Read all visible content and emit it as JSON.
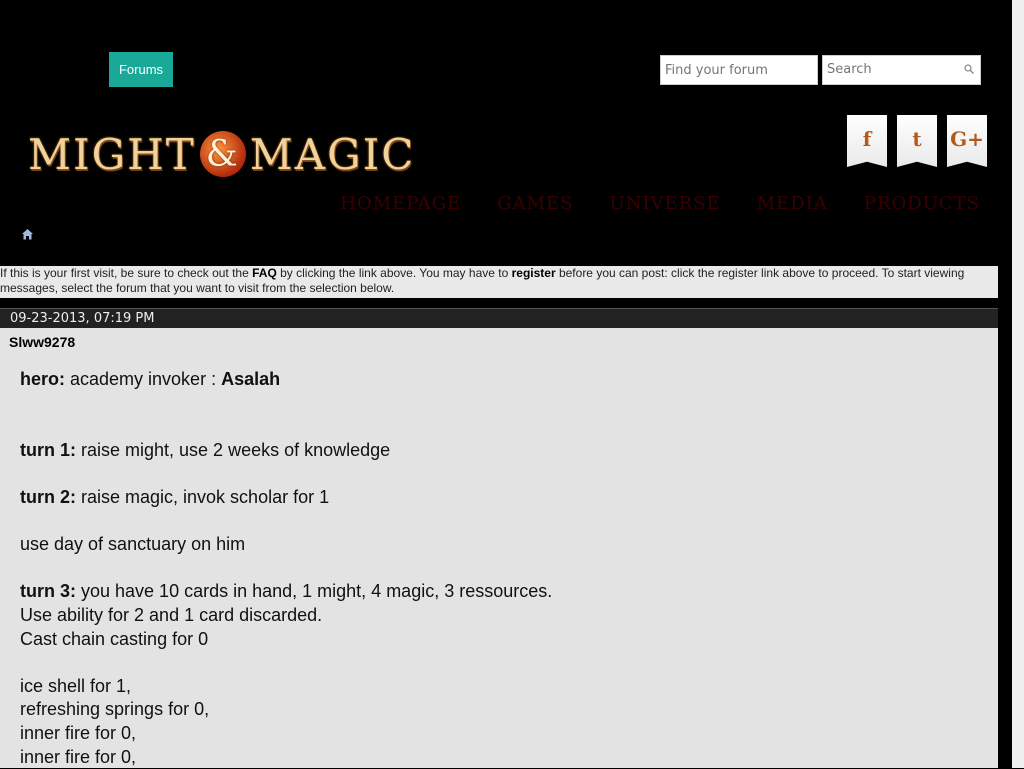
{
  "header": {
    "forums_tab": "Forums",
    "find_forum_placeholder": "Find your forum",
    "search_placeholder": "Search",
    "logo_left": "MIGHT",
    "logo_amp": "&",
    "logo_right": "MAGIC",
    "social": [
      "f",
      "t",
      "G+"
    ],
    "nav": [
      "HOMEPAGE",
      "GAMES",
      "UNIVERSE",
      "MEDIA",
      "PRODUCTS"
    ]
  },
  "notice": {
    "part1": "If this is your first visit, be sure to check out the ",
    "faq": "FAQ",
    "part2": " by clicking the link above. You may have to ",
    "register": "register",
    "part3": " before you can post: click the register link above to proceed. To start viewing messages, select the forum that you want to visit from the selection below."
  },
  "post": {
    "date": "09-23-2013, 07:19 PM",
    "username": "Slww9278",
    "hero_label": "hero:",
    "hero_text": " academy invoker : ",
    "hero_name": "Asalah",
    "turn1_label": "turn 1:",
    "turn1_text": " raise might, use 2 weeks of knowledge",
    "turn2_label": "turn 2:",
    "turn2_text": " raise magic, invok scholar for 1",
    "sanctuary": "use day of sanctuary on him",
    "turn3_label": "turn 3:",
    "turn3_text": " you have 10 cards in hand, 1 might, 4 magic, 3 ressources.",
    "turn3_line2": "Use ability for 2 and 1 card discarded.",
    "turn3_line3": "Cast chain casting for 0",
    "line_ice": "ice shell for 1,",
    "line_springs": "refreshing springs for 0,",
    "line_fire1": "inner fire for 0,",
    "line_fire2": "inner fire for 0,"
  },
  "colors": {
    "forums_tab": "#1aa898",
    "nav_text": "#3a0000",
    "post_header_bg": "#222222",
    "post_body_bg": "#e3e3e3"
  }
}
